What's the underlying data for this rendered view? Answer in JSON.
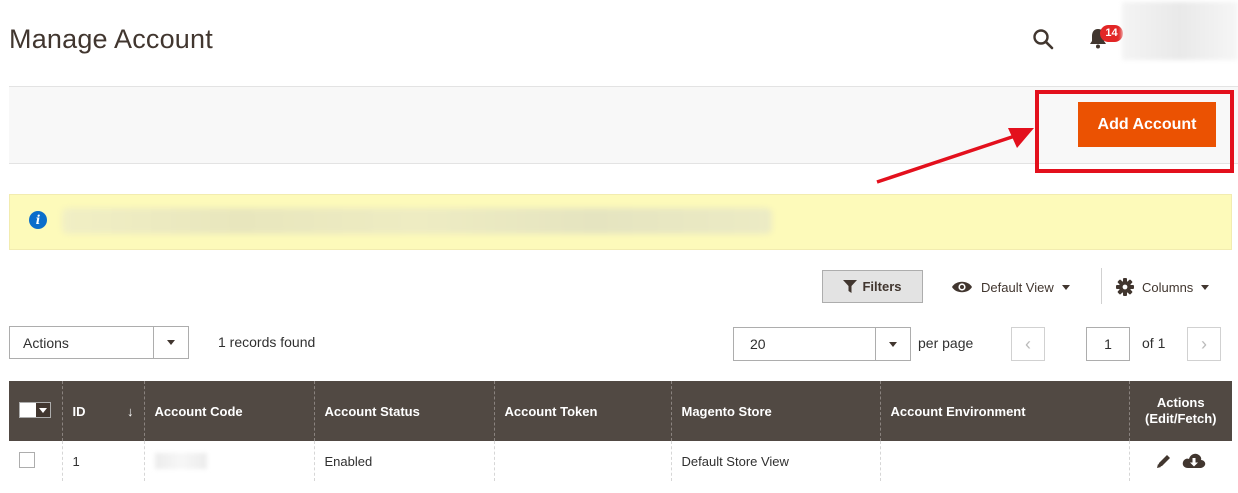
{
  "header": {
    "title": "Manage Account",
    "notification_count": "14"
  },
  "page_actions": {
    "add_label": "Add Account"
  },
  "toolbar": {
    "filters_label": "Filters",
    "view_label": "Default View",
    "columns_label": "Columns",
    "actions_label": "Actions",
    "records_text": "1 records found",
    "per_page_value": "20",
    "per_page_label": "per page",
    "current_page": "1",
    "page_of": "of 1"
  },
  "grid": {
    "columns": [
      "ID",
      "Account Code",
      "Account Status",
      "Account Token",
      "Magento Store",
      "Account Environment",
      "Actions (Edit/Fetch)"
    ],
    "rows": [
      {
        "id": "1",
        "code": "",
        "status": "Enabled",
        "token": "",
        "store": "Default Store View",
        "environment": ""
      }
    ]
  },
  "colors": {
    "accent": "#eb5202",
    "header_bg": "#514943",
    "message_bg": "#fdfaba",
    "annotation": "#e3101d"
  },
  "icons": [
    "search-icon",
    "bell-icon",
    "info-icon",
    "filter-icon",
    "eye-icon",
    "gear-icon",
    "edit-icon",
    "cloud-download-icon"
  ]
}
